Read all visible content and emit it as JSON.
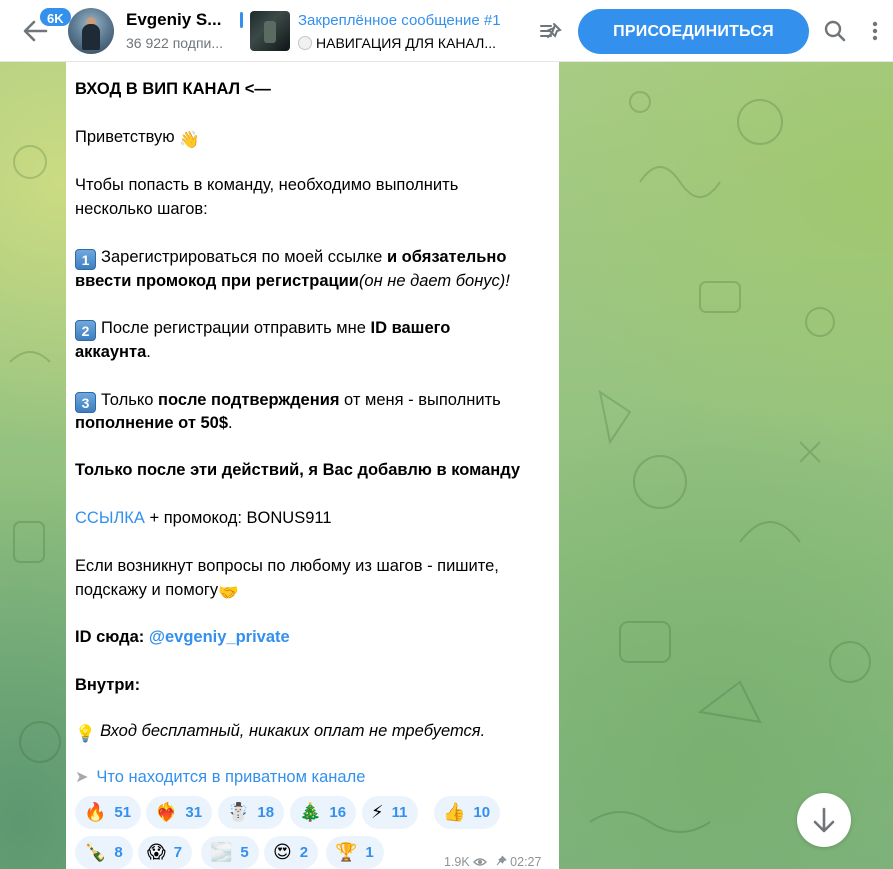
{
  "header": {
    "badge": "6K",
    "title": "Evgeniy S...",
    "subtitle": "36 922 подпи...",
    "pinned": {
      "title": "Закреплённое сообщение #1",
      "text": "НАВИГАЦИЯ ДЛЯ КАНАЛ..."
    },
    "join_label": "ПРИСОЕДИНИТЬСЯ"
  },
  "message": {
    "line1": "ВХОД В ВИП КАНАЛ <—",
    "greeting": "Приветствую",
    "greeting_emoji": "👋",
    "intro_1": "Чтобы попасть в команду, необходимо выполнить",
    "intro_2": "несколько шагов:",
    "step1_num": "1",
    "step1_a": "Зарегистрироваться по моей ссылке",
    "step1_b": " и обязательно",
    "step1_c": "ввести промокод при регистрации",
    "step1_d": "(он не дает бонус)!",
    "step2_num": "2",
    "step2_a": "После регистрации отправить мне ",
    "step2_b": "ID вашего",
    "step2_c": "аккаунта",
    "step2_d": ".",
    "step3_num": "3",
    "step3_a": "Только ",
    "step3_b": "после подтверждения",
    "step3_c": " от меня - выполнить",
    "step3_d": "пополнение от 50$",
    "step3_e": ".",
    "only_after": "Только после эти действий, я Вас добавлю в команду",
    "link_text": "ССЫЛКА",
    "promo_text": " + промокод: BONUS911",
    "questions_1": "Если возникнут вопросы по любому из шагов - пишите,",
    "questions_2": "подскажу и помогу",
    "questions_emoji": "🤝",
    "id_label": "ID сюда: ",
    "id_link": "@evgeniy_private",
    "inside": "Внутри:",
    "free_emoji": "💡",
    "free_text": "Вход бесплатный, никаких оплат не требуется.",
    "forward_arrow": "➤",
    "forward_text": "Что находится в приватном канале"
  },
  "reactions": [
    {
      "emoji": "🔥",
      "count": "51"
    },
    {
      "emoji": "❤️‍🔥",
      "count": "31"
    },
    {
      "emoji": "☃️",
      "count": "18"
    },
    {
      "emoji": "🎄",
      "count": "16"
    },
    {
      "emoji": "⚡",
      "count": "11"
    },
    {
      "emoji": "👍",
      "count": "10"
    },
    {
      "emoji": "🍾",
      "count": "8"
    },
    {
      "emoji": "😱",
      "count": "7"
    },
    {
      "emoji": "🌫️",
      "count": "5"
    },
    {
      "emoji": "😍",
      "count": "2"
    },
    {
      "emoji": "🏆",
      "count": "1"
    }
  ],
  "meta": {
    "views": "1.9K",
    "time": "02:27"
  },
  "icons": {
    "back": "back-arrow-icon",
    "pinned_list": "pinned-list-icon",
    "search": "search-icon",
    "more": "more-vertical-icon",
    "scroll_down": "arrow-down-icon"
  },
  "colors": {
    "accent": "#3390ec",
    "wallpaper": "#a9c58a"
  }
}
